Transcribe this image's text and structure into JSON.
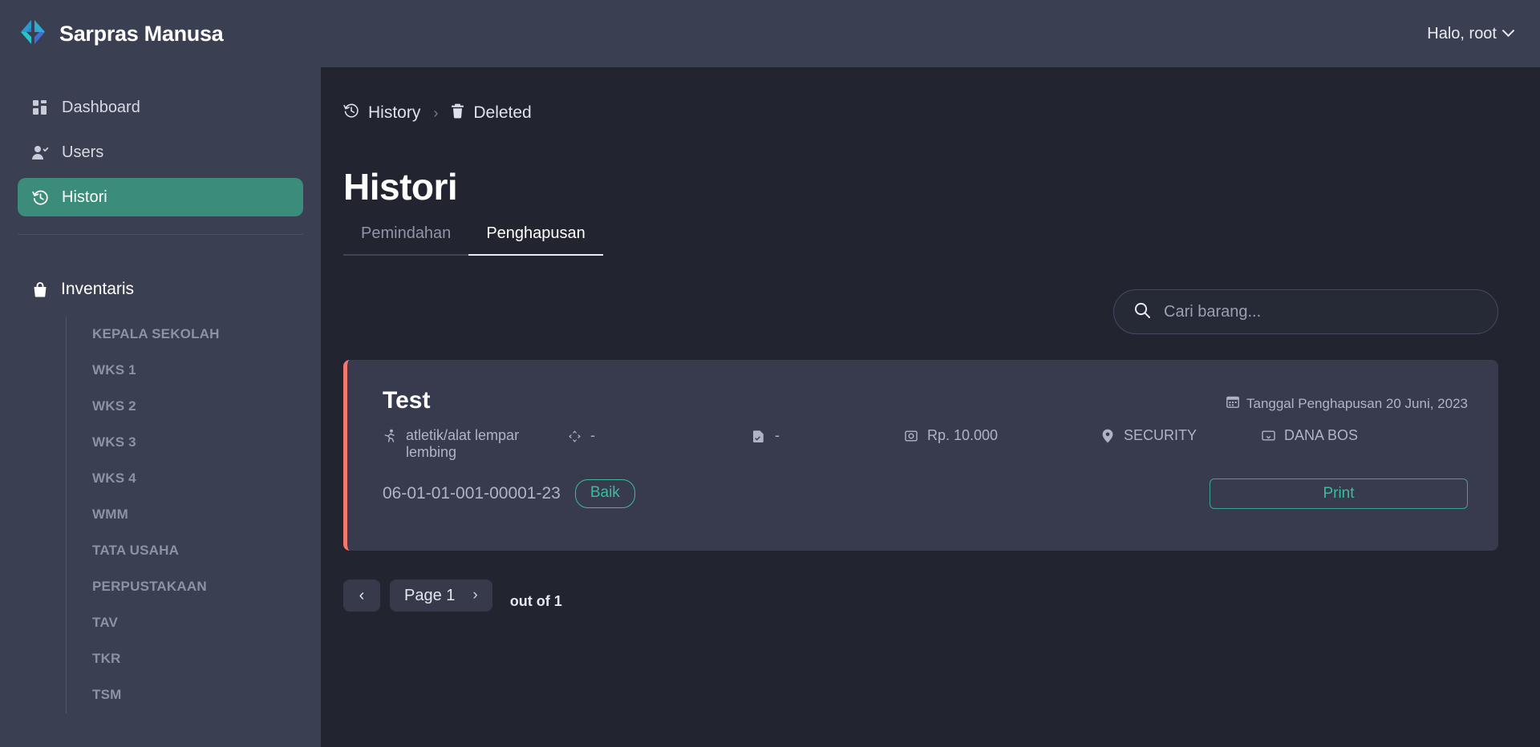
{
  "header": {
    "brand": "Sarpras Manusa",
    "brand_logo_icon": "diamond-chevron-logo",
    "user_label": "Halo, root"
  },
  "sidebar": {
    "items": [
      {
        "label": "Dashboard",
        "icon": "grid-dashboard-icon",
        "active": false
      },
      {
        "label": "Users",
        "icon": "user-check-icon",
        "active": false
      },
      {
        "label": "Histori",
        "icon": "history-clock-icon",
        "active": true
      }
    ],
    "group": {
      "title": "Inventaris",
      "icon": "bag-icon",
      "items": [
        "KEPALA SEKOLAH",
        "WKS 1",
        "WKS 2",
        "WKS 3",
        "WKS 4",
        "WMM",
        "TATA USAHA",
        "PERPUSTAKAAN",
        "TAV",
        "TKR",
        "TSM"
      ]
    }
  },
  "breadcrumb": {
    "items": [
      {
        "label": "History",
        "icon": "history-clock-icon"
      },
      {
        "label": "Deleted",
        "icon": "trash-icon"
      }
    ],
    "separator": "›"
  },
  "main": {
    "title": "Histori",
    "tabs": [
      {
        "label": "Pemindahan",
        "active": false
      },
      {
        "label": "Penghapusan",
        "active": true
      }
    ],
    "search": {
      "placeholder": "Cari barang...",
      "value": "",
      "icon": "search-icon"
    }
  },
  "card": {
    "accent_color": "#f2786f",
    "title": "Test",
    "date_label": "Tanggal Penghapusan 20 Juni, 2023",
    "date_icon": "calendar-icon",
    "meta": [
      {
        "icon": "running-person-icon",
        "value": "atletik/alat lempar lembing"
      },
      {
        "icon": "move-arrows-icon",
        "value": "-"
      },
      {
        "icon": "document-check-icon",
        "value": "-"
      },
      {
        "icon": "photo-icon",
        "value": "Rp. 10.000"
      },
      {
        "icon": "location-pin-icon",
        "value": "SECURITY"
      },
      {
        "icon": "monitor-icon",
        "value": "DANA BOS"
      }
    ],
    "code": "06-01-01-001-00001-23",
    "status": "Baik",
    "status_color": "#3dbb9a",
    "print_label": "Print"
  },
  "pagination": {
    "prev_icon": "‹",
    "next_icon": "›",
    "page_label": "Page 1",
    "out_of": "out of 1"
  }
}
